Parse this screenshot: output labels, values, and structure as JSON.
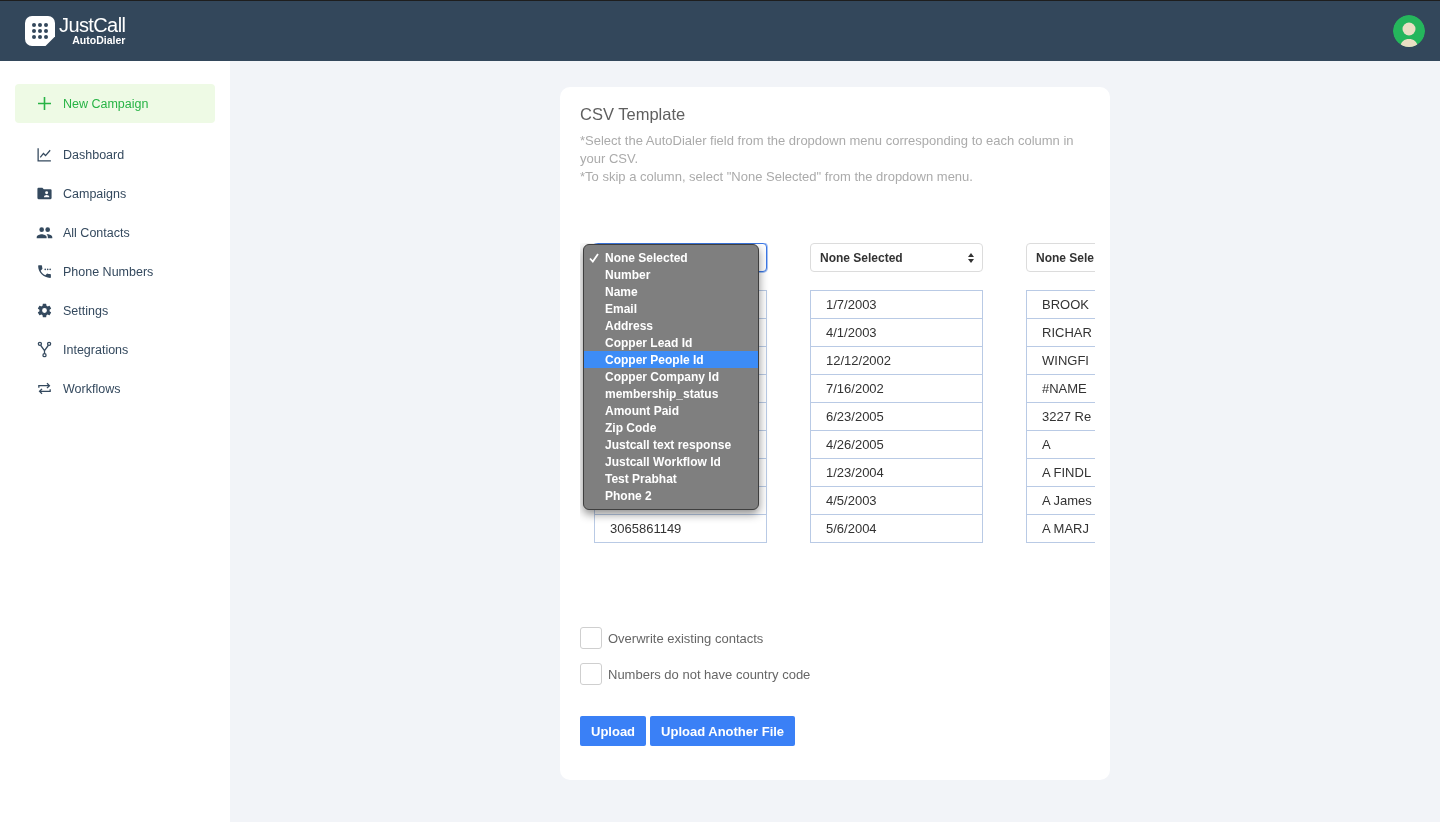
{
  "header": {
    "brand": "JustCall",
    "product": "AutoDialer"
  },
  "sidebar": {
    "new_campaign": {
      "label": "New Campaign"
    },
    "items": [
      {
        "label": "Dashboard",
        "selected": false
      },
      {
        "label": "Campaigns",
        "selected": false
      },
      {
        "label": "All Contacts",
        "selected": false
      },
      {
        "label": "Phone Numbers",
        "selected": false
      },
      {
        "label": "Settings",
        "selected": false
      },
      {
        "label": "Integrations",
        "selected": false
      },
      {
        "label": "Workflows",
        "selected": false
      }
    ]
  },
  "card": {
    "title": "CSV Template",
    "notes": [
      "*Select the AutoDialer field from the dropdown menu corresponding to each column in your CSV.",
      "*To skip a column, select \"None Selected\" from the dropdown menu."
    ],
    "columns": [
      {
        "select": {
          "expanded": true,
          "options": [
            {
              "label": "None Selected",
              "selected": true,
              "highlighted": false
            },
            {
              "label": "Number",
              "selected": false,
              "highlighted": false
            },
            {
              "label": "Name",
              "selected": false,
              "highlighted": false
            },
            {
              "label": "Email",
              "selected": false,
              "highlighted": false
            },
            {
              "label": "Address",
              "selected": false,
              "highlighted": false
            },
            {
              "label": "Copper Lead Id",
              "selected": false,
              "highlighted": false
            },
            {
              "label": "Copper People Id",
              "selected": false,
              "highlighted": true
            },
            {
              "label": "Copper Company Id",
              "selected": false,
              "highlighted": false
            },
            {
              "label": "membership_status",
              "selected": false,
              "highlighted": false
            },
            {
              "label": "Amount Paid",
              "selected": false,
              "highlighted": false
            },
            {
              "label": "Zip Code",
              "selected": false,
              "highlighted": false
            },
            {
              "label": "Justcall text response",
              "selected": false,
              "highlighted": false
            },
            {
              "label": "Justcall Workflow Id",
              "selected": false,
              "highlighted": false
            },
            {
              "label": "Test Prabhat",
              "selected": false,
              "highlighted": false
            },
            {
              "label": "Phone 2",
              "selected": false,
              "highlighted": false
            }
          ]
        }
      },
      {
        "select": {
          "value": "None Selected",
          "expanded": false
        }
      },
      {
        "select": {
          "value": "None Sele",
          "expanded": false
        }
      }
    ],
    "rows": [
      {
        "column_2": "1/7/2003",
        "column_3": "BROOK"
      },
      {
        "column_2": "4/1/2003",
        "column_3": "RICHAR"
      },
      {
        "column_2": "12/12/2002",
        "column_3": "WINGFI"
      },
      {
        "column_2": "7/16/2002",
        "column_3": "#NAME"
      },
      {
        "column_2": "6/23/2005",
        "column_3": "3227 Re"
      },
      {
        "column_2": "4/26/2005",
        "column_3": "A"
      },
      {
        "column_2": "1/23/2004",
        "column_3": "A FINDL"
      },
      {
        "column_2": "4/5/2003",
        "column_3": "A James"
      },
      {
        "column_1": "3065861149",
        "column_2": "5/6/2004",
        "column_3": "A MARJ"
      }
    ],
    "checkboxes": [
      {
        "label": "Overwrite existing contacts",
        "checked": false
      },
      {
        "label": "Numbers do not have country code",
        "checked": false
      }
    ],
    "buttons": [
      "Upload",
      "Upload Another File"
    ]
  }
}
